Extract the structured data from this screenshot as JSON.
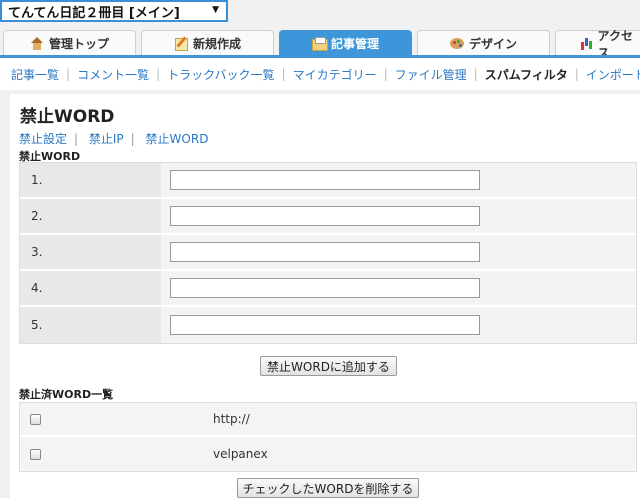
{
  "blog_selector": {
    "value": "てんてん日記２冊目 [メイン]"
  },
  "main_tabs": [
    {
      "label": "管理トップ",
      "icon": "home-icon"
    },
    {
      "label": "新規作成",
      "icon": "pencil-icon"
    },
    {
      "label": "記事管理",
      "icon": "folder-icon",
      "active": true
    },
    {
      "label": "デザイン",
      "icon": "palette-icon"
    },
    {
      "label": "アクセス",
      "icon": "bar-chart-icon"
    }
  ],
  "sub_nav": [
    "記事一覧",
    "コメント一覧",
    "トラックバック一覧",
    "マイカテゴリー",
    "ファイル管理",
    "スパムフィルタ",
    "インポート・エ"
  ],
  "sub_nav_current_index": 5,
  "page": {
    "title": "禁止WORD",
    "links": [
      "禁止設定",
      "禁止IP",
      "禁止WORD"
    ],
    "word_section_label": "禁止WORD",
    "word_rows": [
      {
        "num": "1.",
        "value": ""
      },
      {
        "num": "2.",
        "value": ""
      },
      {
        "num": "3.",
        "value": ""
      },
      {
        "num": "4.",
        "value": ""
      },
      {
        "num": "5.",
        "value": ""
      }
    ],
    "add_button": "禁止WORDに追加する",
    "blocked_section_label": "禁止済WORD一覧",
    "blocked_words": [
      {
        "word": "http://",
        "checked": false
      },
      {
        "word": "velpanex",
        "checked": false
      }
    ],
    "delete_button": "チェックしたWORDを削除する"
  }
}
